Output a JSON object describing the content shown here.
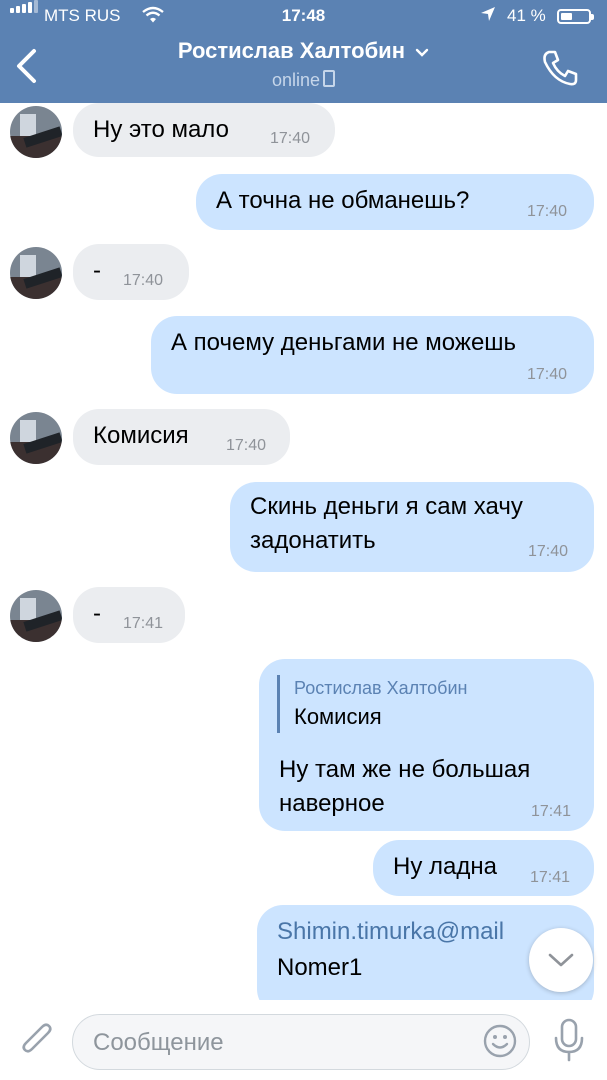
{
  "status_bar": {
    "carrier": "MTS RUS",
    "time": "17:48",
    "battery": "41 %"
  },
  "header": {
    "contact_name": "Ростислав Халтобин",
    "status": "online"
  },
  "messages": [
    {
      "dir": "in",
      "text": "Ну это мало",
      "time": "17:40"
    },
    {
      "dir": "out",
      "text": "А точна не обманешь?",
      "time": "17:40"
    },
    {
      "dir": "in",
      "text": "-",
      "time": "17:40"
    },
    {
      "dir": "out",
      "text": "А почему деньгами не можешь",
      "time": "17:40"
    },
    {
      "dir": "in",
      "text": "Комисия",
      "time": "17:40"
    },
    {
      "dir": "out",
      "lines": [
        "Скинь деньги я сам хачу",
        "задонатить"
      ],
      "time": "17:40"
    },
    {
      "dir": "in",
      "text": "-",
      "time": "17:41"
    },
    {
      "dir": "out",
      "reply_to": {
        "name": "Ростислав Халтобин",
        "text": "Комисия"
      },
      "lines": [
        "Ну там же не большая",
        "наверное"
      ],
      "time": "17:41"
    },
    {
      "dir": "out",
      "text": "Ну ладна",
      "time": "17:41"
    },
    {
      "dir": "out",
      "link": "Shimin.timurka@mail",
      "text2": "Nomer1"
    }
  ],
  "composer": {
    "placeholder": "Сообщение"
  },
  "icons": {
    "back": "chevron-left-icon",
    "call": "phone-icon",
    "attach": "paperclip-icon",
    "emoji": "smile-icon",
    "mic": "microphone-icon",
    "scroll_down": "chevron-down-icon"
  },
  "colors": {
    "header_bg": "#5b82b3",
    "incoming_bubble": "#ebedf0",
    "outgoing_bubble": "#cce4ff",
    "link": "#4a76a8"
  }
}
